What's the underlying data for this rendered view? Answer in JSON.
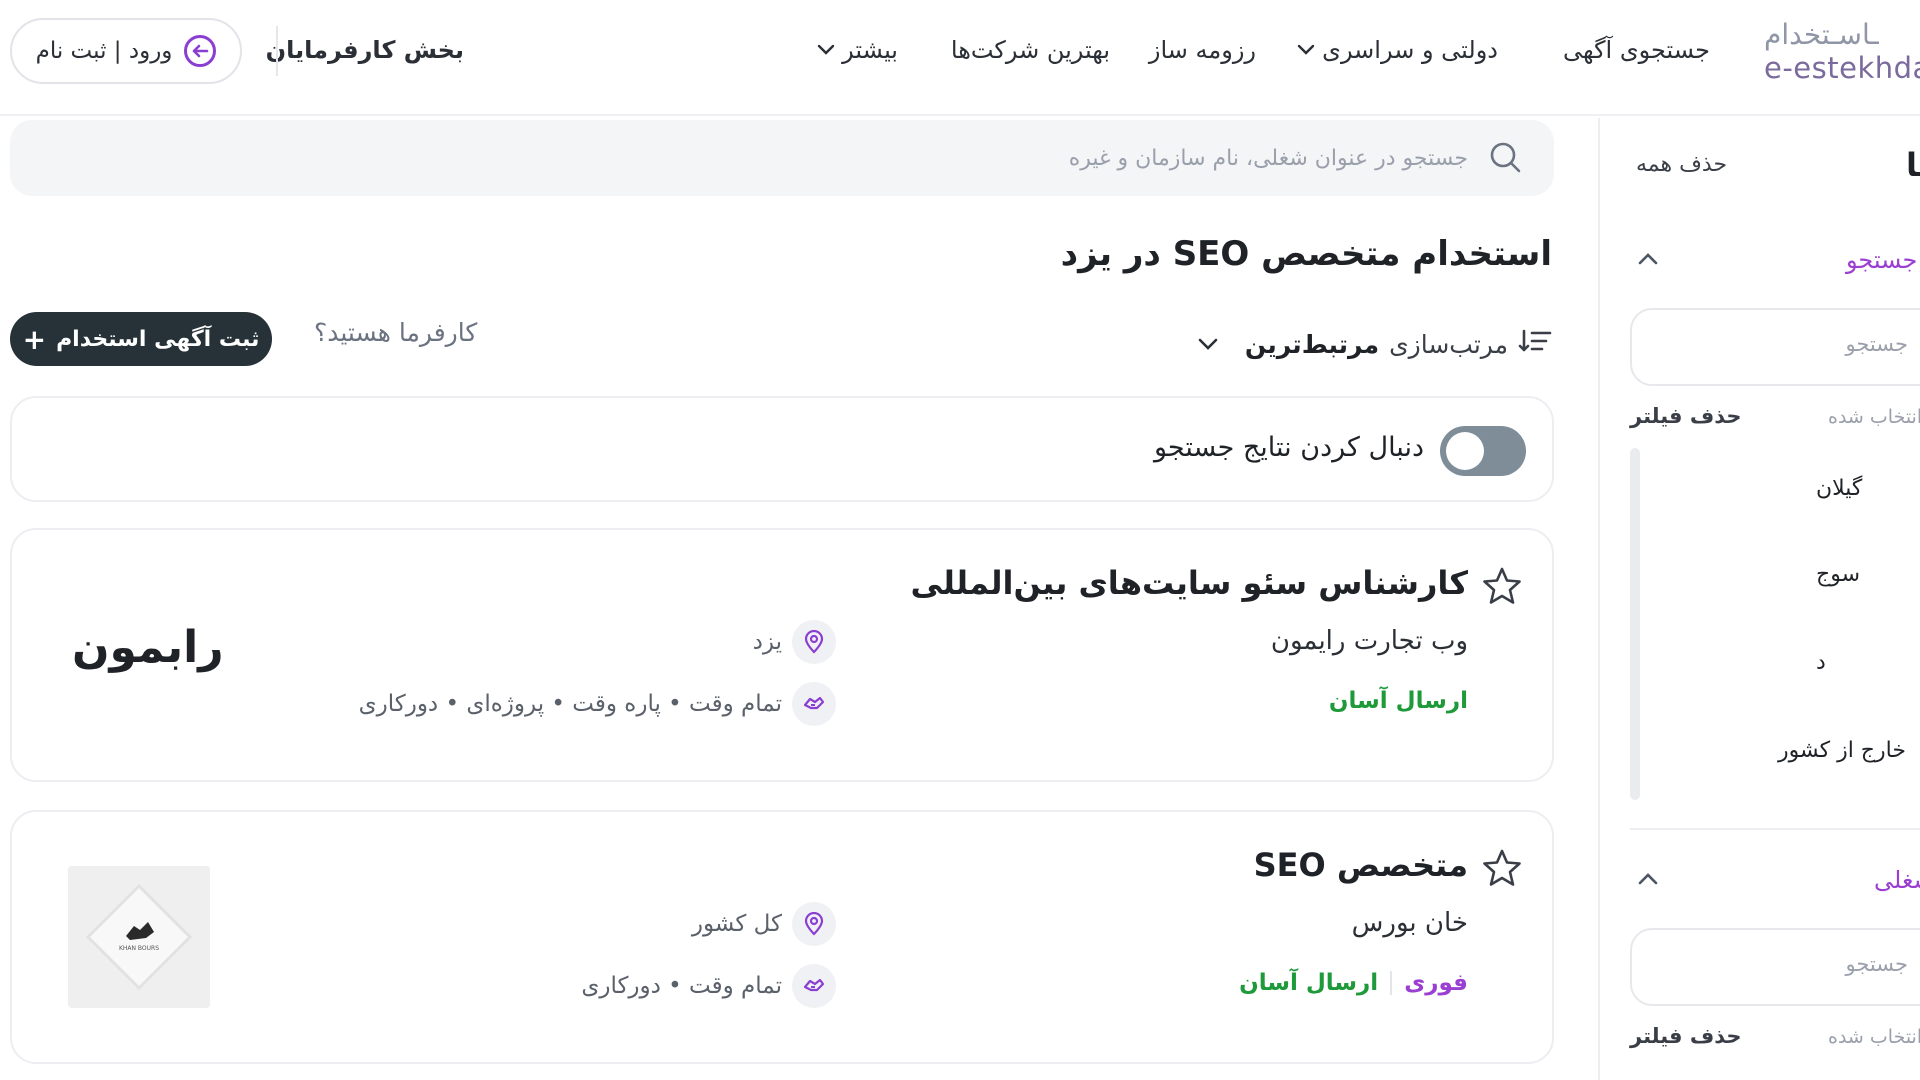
{
  "header": {
    "logo_fa": "ـاسـتخدام",
    "logo_en": "e-estekhdam",
    "nav": {
      "search_jobs": "جستجوی آگهی",
      "government": "دولتی و سراسری",
      "resume_builder": "رزومه ساز",
      "best_companies": "بهترین شرکت‌ها",
      "more": "بیشتر"
    },
    "employers": "بخش کارفرمایان",
    "login": "ورود | ثبت نام"
  },
  "search": {
    "placeholder": "جستجو در عنوان شغلی، نام سازمان و غیره"
  },
  "page": {
    "title": "استخدام متخصص SEO در یزد",
    "sort_label": "مرتب‌سازی",
    "sort_value": "مرتبط‌ترین",
    "employer_question": "کارفرما هستید؟",
    "post_job": "ثبت آگهی استخدام"
  },
  "follow": {
    "label": "دنبال کردن نتایج جستجو",
    "enabled": false
  },
  "jobs": [
    {
      "title": "کارشناس سئو سایت‌های بین‌المللی",
      "company": "وب تجارت رایمون",
      "badges": [
        "ارسال آسان"
      ],
      "location": "یزد",
      "types": "تمام وقت • پاره وقت • پروژه‌ای • دورکاری",
      "logo_text": "رابمون"
    },
    {
      "title": "متخصص SEO",
      "company": "خان بورس",
      "badge_urgent": "فوری",
      "badge_easy": "ارسال آسان",
      "location": "کل کشور",
      "types": "تمام وقت • دورکاری",
      "logo_caption": "KHAN BOURS"
    }
  ],
  "filters": {
    "title": "فیلترها",
    "clear_all": "حذف همه",
    "sections": [
      {
        "heading": "جستجو",
        "input_placeholder": "جستجو",
        "selected_label": "انتخاب شده",
        "remove_label": "حذف فیلتر",
        "items": [
          "گیلان",
          "سوج",
          "د",
          "خارج از کشور"
        ]
      },
      {
        "heading": "شغلی",
        "input_placeholder": "جستجو",
        "selected_label": "انتخاب شده",
        "remove_label": "حذف فیلتر"
      }
    ]
  },
  "colors": {
    "accent_purple": "#9a3fd1",
    "easy_green": "#1f9a3a",
    "dark_button": "#263238"
  }
}
